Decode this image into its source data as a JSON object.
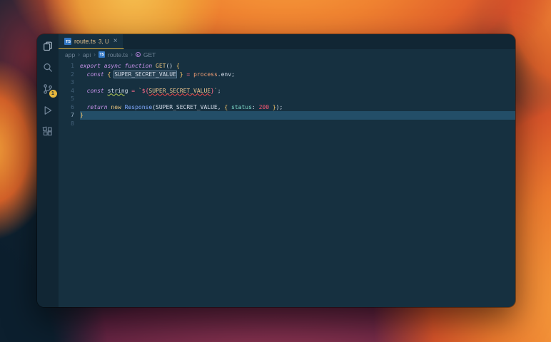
{
  "colors": {
    "editor_bg": "#163040",
    "chrome_bg": "#112634",
    "tab_accent": "#ddb23f",
    "badge_bg": "#e7b73c",
    "ts_icon_bg": "#3178c6",
    "line_highlight": "#234e68",
    "wallpaper_orange": "#ef8130",
    "wallpaper_navy": "#0e2231",
    "wallpaper_maroon": "#82304d"
  },
  "activity_bar": {
    "items": [
      {
        "name": "explorer"
      },
      {
        "name": "search"
      },
      {
        "name": "source-control",
        "badge": "1"
      },
      {
        "name": "run-and-debug"
      },
      {
        "name": "extensions"
      }
    ]
  },
  "tab": {
    "file_icon_label": "TS",
    "title": "route.ts",
    "decoration": "3, U",
    "close": "×"
  },
  "breadcrumb": {
    "separator": "›",
    "path": [
      "app",
      "api",
      "route.ts"
    ],
    "symbol": "GET"
  },
  "editor": {
    "lines": [
      {
        "n": "1",
        "tokens": [
          {
            "t": "export",
            "c": "kw"
          },
          {
            "t": " ",
            "c": "p"
          },
          {
            "t": "async",
            "c": "kw"
          },
          {
            "t": " ",
            "c": "p"
          },
          {
            "t": "function",
            "c": "kw"
          },
          {
            "t": " ",
            "c": "p"
          },
          {
            "t": "GET",
            "c": "fn"
          },
          {
            "t": "() ",
            "c": "p"
          },
          {
            "t": "{",
            "c": "br"
          }
        ]
      },
      {
        "n": "2",
        "tokens": [
          {
            "t": "  ",
            "c": "p"
          },
          {
            "t": "const",
            "c": "kw"
          },
          {
            "t": " ",
            "c": "p"
          },
          {
            "t": "{",
            "c": "br"
          },
          {
            "t": " ",
            "c": "p"
          },
          {
            "t": "SUPER_SECRET_VALUE",
            "c": "var",
            "x": "boxed"
          },
          {
            "t": " ",
            "c": "p"
          },
          {
            "t": "}",
            "c": "br"
          },
          {
            "t": " ",
            "c": "p"
          },
          {
            "t": "=",
            "c": "op"
          },
          {
            "t": " ",
            "c": "p"
          },
          {
            "t": "process",
            "c": "obj"
          },
          {
            "t": ".",
            "c": "p"
          },
          {
            "t": "env",
            "c": "p"
          },
          {
            "t": ";",
            "c": "p"
          }
        ]
      },
      {
        "n": "3",
        "tokens": []
      },
      {
        "n": "4",
        "tokens": [
          {
            "t": "  ",
            "c": "p"
          },
          {
            "t": "const",
            "c": "kw"
          },
          {
            "t": " ",
            "c": "p"
          },
          {
            "t": "string",
            "c": "var",
            "x": "wavy-warn"
          },
          {
            "t": " ",
            "c": "p"
          },
          {
            "t": "=",
            "c": "op"
          },
          {
            "t": " ",
            "c": "p"
          },
          {
            "t": "`",
            "c": "str"
          },
          {
            "t": "${",
            "c": "tpl"
          },
          {
            "t": "SUPER_SECRET_VALUE",
            "c": "str",
            "x": "wavy-err"
          },
          {
            "t": "}",
            "c": "tpl"
          },
          {
            "t": "`",
            "c": "str"
          },
          {
            "t": ";",
            "c": "p"
          }
        ]
      },
      {
        "n": "5",
        "tokens": []
      },
      {
        "n": "6",
        "tokens": [
          {
            "t": "  ",
            "c": "p"
          },
          {
            "t": "return",
            "c": "kw"
          },
          {
            "t": " ",
            "c": "p"
          },
          {
            "t": "new",
            "c": "fn"
          },
          {
            "t": " ",
            "c": "p"
          },
          {
            "t": "Response",
            "c": "cls"
          },
          {
            "t": "(",
            "c": "p"
          },
          {
            "t": "SUPER_SECRET_VALUE",
            "c": "var"
          },
          {
            "t": ", ",
            "c": "p"
          },
          {
            "t": "{",
            "c": "br"
          },
          {
            "t": " ",
            "c": "p"
          },
          {
            "t": "status",
            "c": "attr"
          },
          {
            "t": ": ",
            "c": "p"
          },
          {
            "t": "200",
            "c": "num"
          },
          {
            "t": " ",
            "c": "p"
          },
          {
            "t": "}",
            "c": "br"
          },
          {
            "t": ")",
            "c": "p"
          },
          {
            "t": ";",
            "c": "p"
          }
        ]
      },
      {
        "n": "7",
        "active": true,
        "tokens": [
          {
            "t": "}",
            "c": "br"
          }
        ]
      },
      {
        "n": "8",
        "tokens": []
      }
    ]
  }
}
